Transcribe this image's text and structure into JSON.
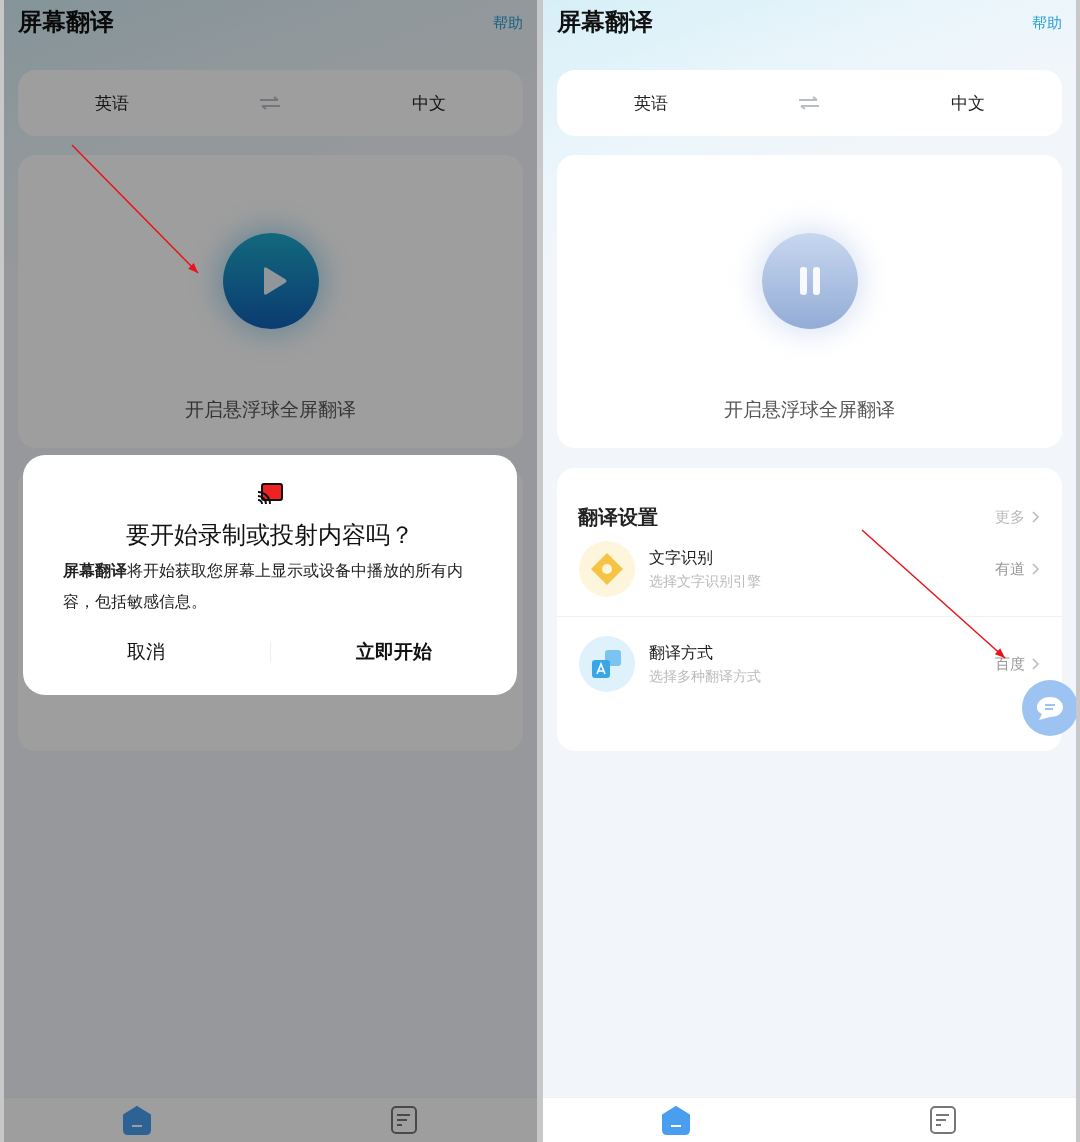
{
  "panels": [
    {
      "dimmed": true,
      "arrow": true,
      "header": {
        "title": "屏幕翻译",
        "help": "帮助"
      },
      "languages": {
        "source": "英语",
        "target": "中文"
      },
      "toggle": {
        "running": false,
        "label": "开启悬浮球全屏翻译"
      },
      "dialog": {
        "title": "要开始录制或投射内容吗？",
        "message": "**屏幕翻译**将开始获取您屏幕上显示或设备中播放的所有内容，包括敏感信息。",
        "buttons": [
          {
            "label": "取消",
            "primary": false
          },
          {
            "label": "立即开始",
            "primary": true
          }
        ]
      },
      "nav": [
        {
          "selected": true
        },
        {
          "selected": false
        }
      ]
    },
    {
      "dimmed": false,
      "arrow": true,
      "chat_bubble": true,
      "header": {
        "title": "屏幕翻译",
        "help": "帮助"
      },
      "languages": {
        "source": "英语",
        "target": "中文"
      },
      "toggle": {
        "running": true,
        "label": "开启悬浮球全屏翻译"
      },
      "settings": {
        "title": "翻译设置",
        "more": "更多",
        "items": [
          {
            "title": "文字识别",
            "subtitle": "选择文字识别引擎",
            "value": "有道"
          },
          {
            "title": "翻译方式",
            "subtitle": "选择多种翻译方式",
            "value": "百度"
          }
        ]
      },
      "nav": [
        {
          "selected": true
        },
        {
          "selected": false
        }
      ]
    }
  ]
}
